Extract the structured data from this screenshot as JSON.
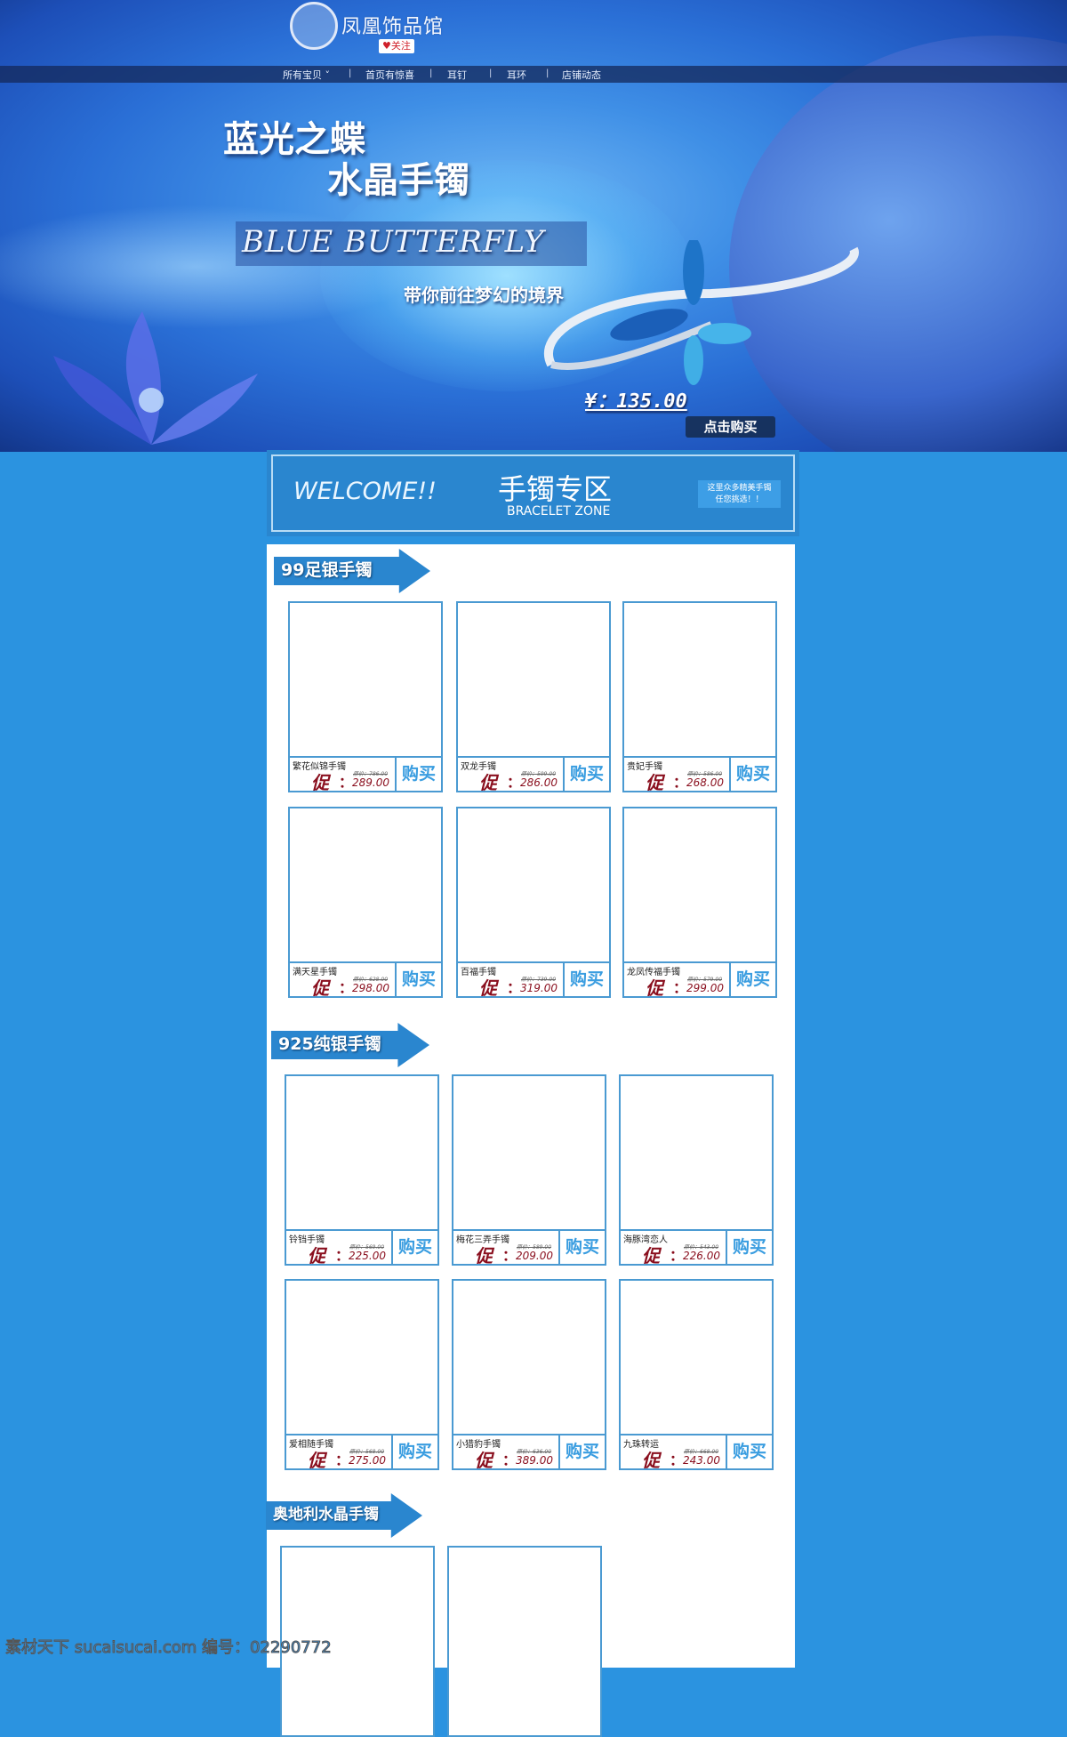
{
  "header": {
    "shop_name": "凤凰饰品馆",
    "follow_label": "关注",
    "nav": [
      "所有宝贝 ˅",
      "首页有惊喜",
      "耳钉",
      "耳环",
      "店铺动态"
    ],
    "nav_separator": "|"
  },
  "banner": {
    "headline_1": "蓝光之蝶",
    "headline_2": "水晶手镯",
    "english_title": "BLUE BUTTERFLY",
    "tagline": "带你前往梦幻的境界",
    "price": "¥：135.00",
    "buy_now": "点击购买"
  },
  "welcome": {
    "welcome_text": "WELCOME!!",
    "zone_title": "手镯专区",
    "zone_subtitle": "BRACELET ZONE",
    "note_line1": "这里众多精美手镯",
    "note_line2": "任您挑选！！"
  },
  "product_labels": {
    "promo": "促",
    "colon": "：",
    "orig_prefix": "原价：",
    "buy": "购买"
  },
  "sections": [
    {
      "title": "99足银手镯",
      "products": [
        {
          "name": "繁花似锦手镯",
          "orig": "786.00",
          "price": "289.00"
        },
        {
          "name": "双龙手镯",
          "orig": "599.00",
          "price": "286.00"
        },
        {
          "name": "贵妃手镯",
          "orig": "586.00",
          "price": "268.00"
        },
        {
          "name": "满天星手镯",
          "orig": "628.00",
          "price": "298.00"
        },
        {
          "name": "百福手镯",
          "orig": "739.00",
          "price": "319.00"
        },
        {
          "name": "龙凤传福手镯",
          "orig": "579.00",
          "price": "299.00"
        }
      ]
    },
    {
      "title": "925纯银手镯",
      "products": [
        {
          "name": "铃铛手镯",
          "orig": "569.00",
          "price": "225.00"
        },
        {
          "name": "梅花三弄手镯",
          "orig": "589.00",
          "price": "209.00"
        },
        {
          "name": "海豚湾恋人",
          "orig": "543.00",
          "price": "226.00"
        },
        {
          "name": "爱相随手镯",
          "orig": "568.00",
          "price": "275.00"
        },
        {
          "name": "小猎豹手镯",
          "orig": "636.00",
          "price": "389.00"
        },
        {
          "name": "九珠转运",
          "orig": "668.00",
          "price": "243.00"
        }
      ]
    },
    {
      "title": "奥地利水晶手镯",
      "products": [
        {},
        {}
      ]
    }
  ],
  "watermark": "素材天下 sucaisucai.com  编号：02290772",
  "colors": {
    "page_bg": "#2b93e0",
    "card_border": "#4a9ad2",
    "promo_red": "#8a0f1e",
    "buy_blue": "#3a9de0"
  }
}
